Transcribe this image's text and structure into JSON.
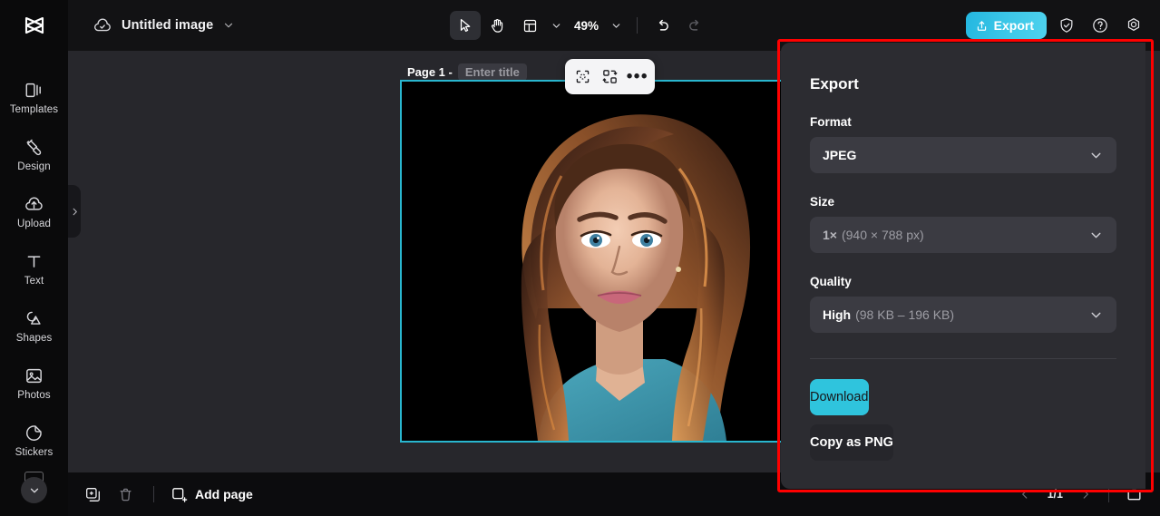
{
  "app": {
    "logo": "capcut-logo",
    "document_title": "Untitled image",
    "cloud_status_icon": "cloud-check-icon"
  },
  "toolbar": {
    "select_tool_icon": "cursor-arrow-icon",
    "hand_tool_icon": "hand-icon",
    "layout_tool_icon": "layout-grid-icon",
    "zoom_level": "49%",
    "undo_icon": "undo-arrow-icon",
    "redo_icon": "redo-arrow-icon",
    "export_label": "Export",
    "export_icon": "upload-icon",
    "shield_icon": "shield-check-icon",
    "help_icon": "question-circle-icon",
    "settings_icon": "gear-icon"
  },
  "sidebar": {
    "items": [
      {
        "label": "Templates",
        "icon": "templates-icon"
      },
      {
        "label": "Design",
        "icon": "design-icon"
      },
      {
        "label": "Upload",
        "icon": "upload-cloud-icon"
      },
      {
        "label": "Text",
        "icon": "text-t-icon"
      },
      {
        "label": "Shapes",
        "icon": "shapes-icon"
      },
      {
        "label": "Photos",
        "icon": "photo-icon"
      },
      {
        "label": "Stickers",
        "icon": "sticker-icon"
      }
    ],
    "scroll_down_icon": "chevron-down-icon",
    "collapse_handle_icon": "chevron-right-icon"
  },
  "canvas": {
    "page_number_label": "Page 1 -",
    "page_title_placeholder": "Enter title",
    "page_title_value": "",
    "selection_color": "#29b6cf",
    "floating_toolbar": {
      "crop_icon": "crop-select-icon",
      "replace_icon": "replace-swap-icon",
      "more_label": "•••",
      "more_icon": "more-horizontal-icon"
    }
  },
  "export": {
    "title": "Export",
    "format_label": "Format",
    "format_value": "JPEG",
    "size_label": "Size",
    "size_value": "1×",
    "size_detail": "(940 × 788 px)",
    "quality_label": "Quality",
    "quality_value": "High",
    "quality_detail": "(98 KB – 196 KB)",
    "download_label": "Download",
    "copy_label": "Copy as PNG",
    "caret_icon": "chevron-down-icon",
    "accent_color": "#2fc4dd"
  },
  "bottombar": {
    "duplicate_icon": "duplicate-page-icon",
    "delete_icon": "trash-icon",
    "add_page_label": "Add page",
    "add_page_icon": "add-square-icon",
    "prev_icon": "chevron-left-icon",
    "next_icon": "chevron-right-icon",
    "page_indicator": "1/1",
    "grid_view_icon": "page-view-icon"
  },
  "annotation": {
    "color": "#ff0000",
    "shape": "rectangle-highlight"
  }
}
